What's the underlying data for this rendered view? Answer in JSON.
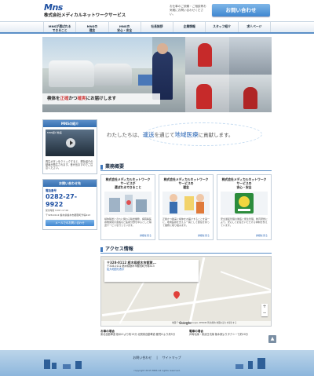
{
  "header": {
    "logo": "Mns",
    "company": "株式会社メディカルネットワークサービス",
    "contact_note": "お仕事のご依頼・ご相談等お気軽にお問い合わせください。",
    "contact_button": "お問い合わせ"
  },
  "nav": {
    "items": [
      {
        "label": "MNSが選ばれる\nできること"
      },
      {
        "label": "MNSの\n理念"
      },
      {
        "label": "MNSの\n安心・安全"
      },
      {
        "label": "社長挨拶"
      },
      {
        "label": "企業情報"
      },
      {
        "label": "スタッフ紹介"
      },
      {
        "label": "求人ページ"
      }
    ]
  },
  "hero": {
    "caption_pre": "検体を",
    "caption_hl1": "正確",
    "caption_mid": "かつ",
    "caption_hl2": "確実",
    "caption_post": "にお届けします"
  },
  "sidebar": {
    "video_title": "MNSの紹介",
    "video_caption": "MNS紹介動画",
    "video_text": "再生ボタンをクリックすると、弊社紹介の動画が再生されます。音が出ますのでご注意ください。",
    "contact_title": "お問い合わせ先",
    "tel_label": "電話番号",
    "tel": "0282-27-9922",
    "tel_hours": "受付時間 9:00〜17:00",
    "address": "〒328-0112 栃木県栃木市都賀町升塚413",
    "form_button": "メールでのお問い合わせ"
  },
  "slogan": {
    "pre": "わたしたちは、",
    "hl1": "運送",
    "mid": "を通じて",
    "hl2": "地域医療",
    "post": "に貢献します。"
  },
  "business": {
    "title": "業務概要",
    "cards": [
      {
        "title": "株式会社メディカルネットワーク\nサービスが\n選ばれるできること",
        "text": "検体輸送とそれに関わる輸送業務、病院等医療機関間の運搬など医療分野を中心とした輸送サービスを行っています。",
        "more": "詳細を見る"
      },
      {
        "title": "株式会社メディカルネットワーク\nサービスの\n理念",
        "text": "正確かつ確実に検体をお届けすることを第一に、地域医療を支える一員として責任を持って業務に取り組みます。",
        "more": "詳細を見る"
      },
      {
        "title": "株式会社メディカルネットワーク\nサービスの\n安心・安全",
        "text": "安全運転管理の徹底と衛生管理、教育研修により、安心してお任せいただける体制を整えています。",
        "more": "詳細を見る"
      }
    ]
  },
  "access": {
    "title": "アクセス情報",
    "map_address_title": "〒328-0112 栃木県栃木市都賀...",
    "map_address_line": "〒328-0112 栃木県栃木市都賀町升塚413",
    "map_link": "拡大地図を表示",
    "map_footer": "地図データ ©2015 Google, ZENRIN 利用規約 地図の誤りを報告する",
    "google": "Google",
    "by_car_title": "お車の場合",
    "by_car_text": "東北自動車道 栃木ICより約15分\n北関東自動車道 都賀ICより約5分",
    "by_train_title": "電車の場合",
    "by_train_text": "JR両毛線・東武日光線 栃木駅よりタクシーで約20分"
  },
  "footer": {
    "link1": "お問い合わせ",
    "link2": "サイトマップ",
    "copyright": "copyright 2015 MNS All rights reserved.",
    "pagetop": "▲"
  }
}
